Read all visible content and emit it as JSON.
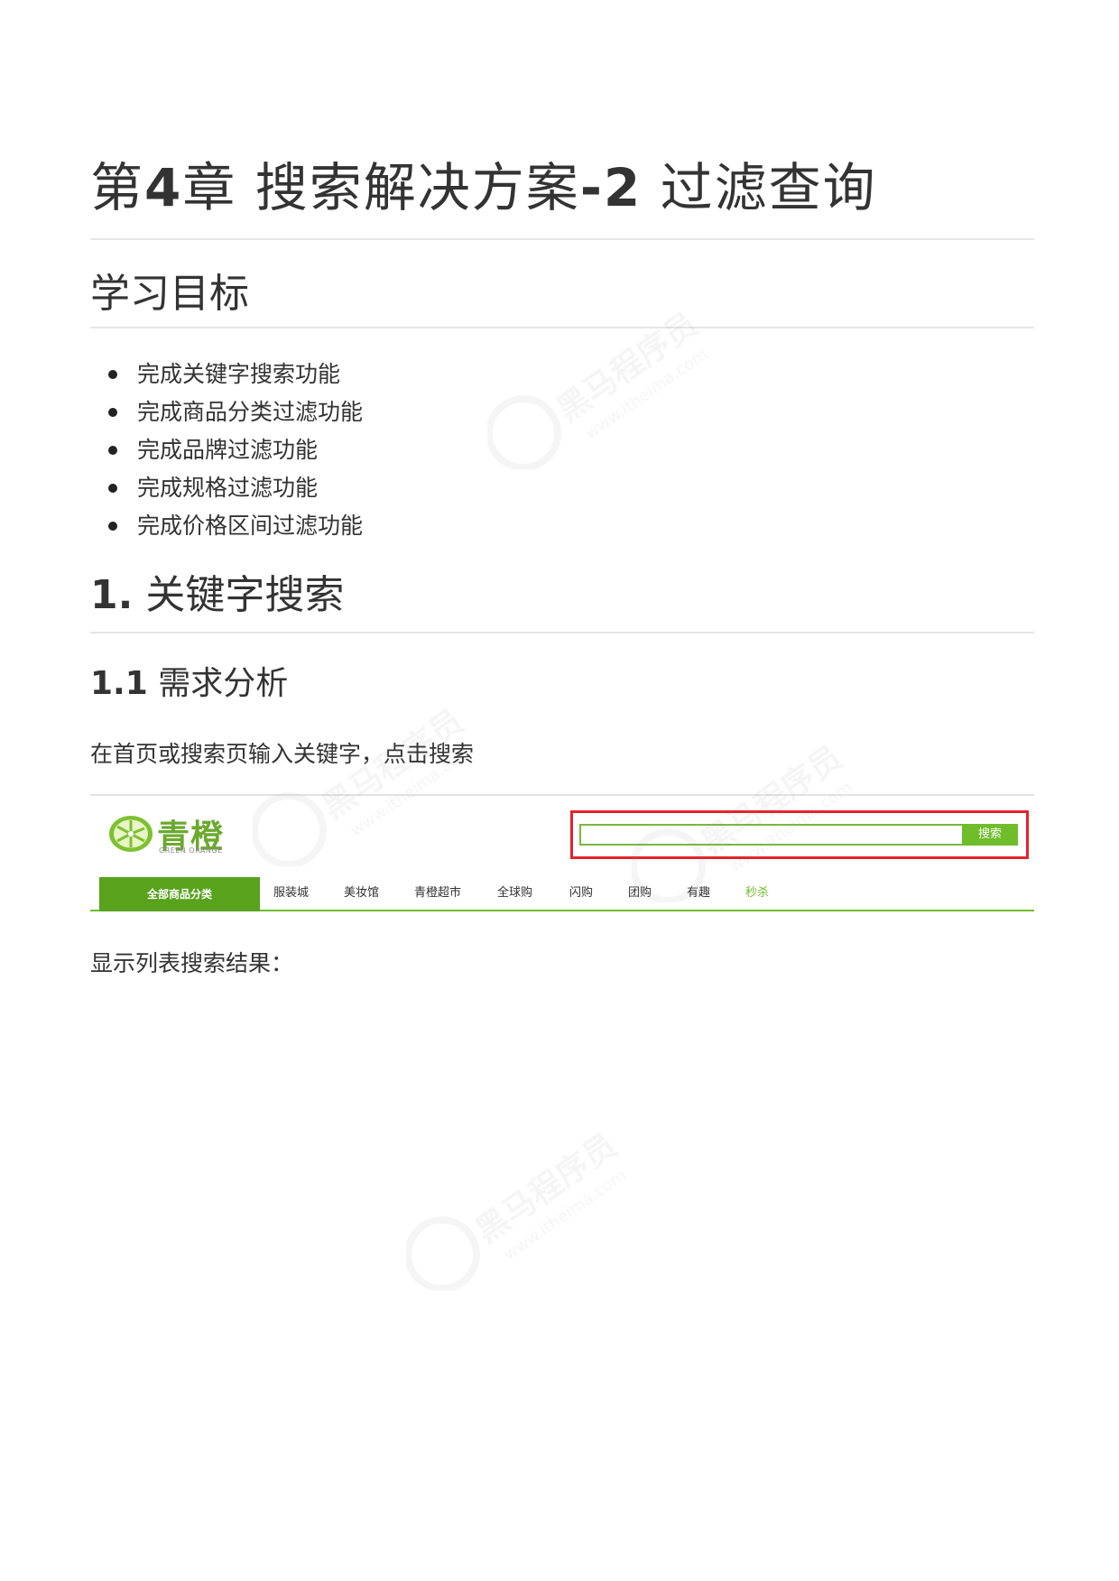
{
  "document": {
    "chapter_title_prefix": "第",
    "chapter_number": "4",
    "chapter_title_mid": "章  搜索解决方案",
    "chapter_title_num": "-2",
    "chapter_title_suffix": " 过滤查询",
    "goals_heading": "学习目标",
    "goals": [
      "完成关键字搜索功能",
      "完成商品分类过滤功能",
      "完成品牌过滤功能",
      "完成规格过滤功能",
      "完成价格区间过滤功能"
    ],
    "section1_number": "1.",
    "section1_title": " 关键字搜索",
    "section11_number": "1.1",
    "section11_title": " 需求分析",
    "para1": "在首页或搜索页输入关键字，点击搜索",
    "para2": "显示列表搜索结果："
  },
  "shop_header": {
    "logo_text": "青橙",
    "logo_subtext": "GREEN ORANGE",
    "search_button_label": "搜索",
    "search_placeholder": "",
    "all_categories_label": "全部商品分类",
    "nav_items": [
      "服装城",
      "美妆馆",
      "青橙超市",
      "全球购",
      "闪购",
      "团购",
      "有趣",
      "秒杀"
    ],
    "accent_color": "#6fbd2a",
    "highlight_color": "#e5232a"
  },
  "watermark": {
    "text_cn": "黑马程序员",
    "text_url": "www.itheima.com"
  }
}
